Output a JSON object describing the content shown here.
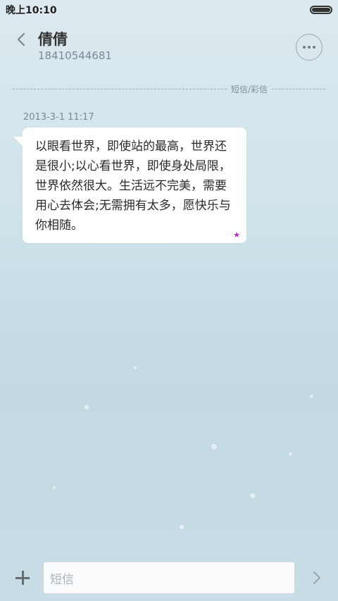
{
  "status_bar": {
    "time": "晚上10:10"
  },
  "header": {
    "contact_name": "倩倩",
    "contact_number": "18410544681"
  },
  "thread": {
    "divider_label": "短信/彩信",
    "messages": [
      {
        "timestamp": "2013-3-1 11:17",
        "text": "以眼看世界，即使站的最高，世界还是很小;以心看世界，即使身处局限，世界依然很大。生活远不完美，需要用心去体会;无需拥有太多，愿快乐与你相随。",
        "starred_icon": "star-icon",
        "star_color": "#c02ac6"
      }
    ]
  },
  "composer": {
    "placeholder": "短信"
  },
  "icons": {
    "back": "chevron-left-icon",
    "more": "more-dots-icon",
    "add": "plus-icon",
    "send": "chevron-right-icon"
  }
}
